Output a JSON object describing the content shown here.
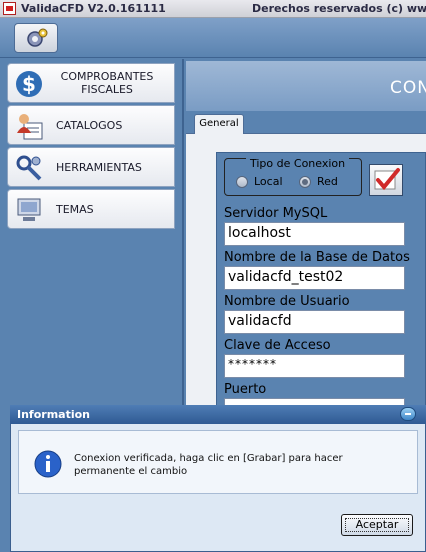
{
  "window": {
    "title": "ValidaCFD V2.0.161111",
    "copyright": "Derechos reservados (c) www."
  },
  "toolbar": {
    "settings_icon": "gear-settings-icon"
  },
  "nav": {
    "items": [
      {
        "label": "COMPROBANTES FISCALES",
        "icon": "dollar-icon"
      },
      {
        "label": "CATALOGOS",
        "icon": "user-card-icon"
      },
      {
        "label": "HERRAMIENTAS",
        "icon": "tools-icon"
      },
      {
        "label": "TEMAS",
        "icon": "monitor-icon"
      }
    ]
  },
  "main": {
    "title": "CON",
    "tab": "General",
    "connection_group": {
      "title": "Tipo de Conexion",
      "options": [
        {
          "label": "Local",
          "selected": false
        },
        {
          "label": "Red",
          "selected": true
        }
      ]
    },
    "fields": {
      "server_label": "Servidor MySQL",
      "server_value": "localhost",
      "db_label": "Nombre de la Base de Datos",
      "db_value": "validacfd_test02",
      "user_label": "Nombre de Usuario",
      "user_value": "validacfd",
      "password_label": "Clave de Acceso",
      "password_value": "*******",
      "port_label": "Puerto"
    }
  },
  "dialog": {
    "title": "Information",
    "message": "Conexion verificada, haga clic en [Grabar] para hacer permanente el cambio",
    "ok_label": "Aceptar"
  },
  "colors": {
    "panel": "#5a83b0",
    "accent": "#2f5a93"
  }
}
